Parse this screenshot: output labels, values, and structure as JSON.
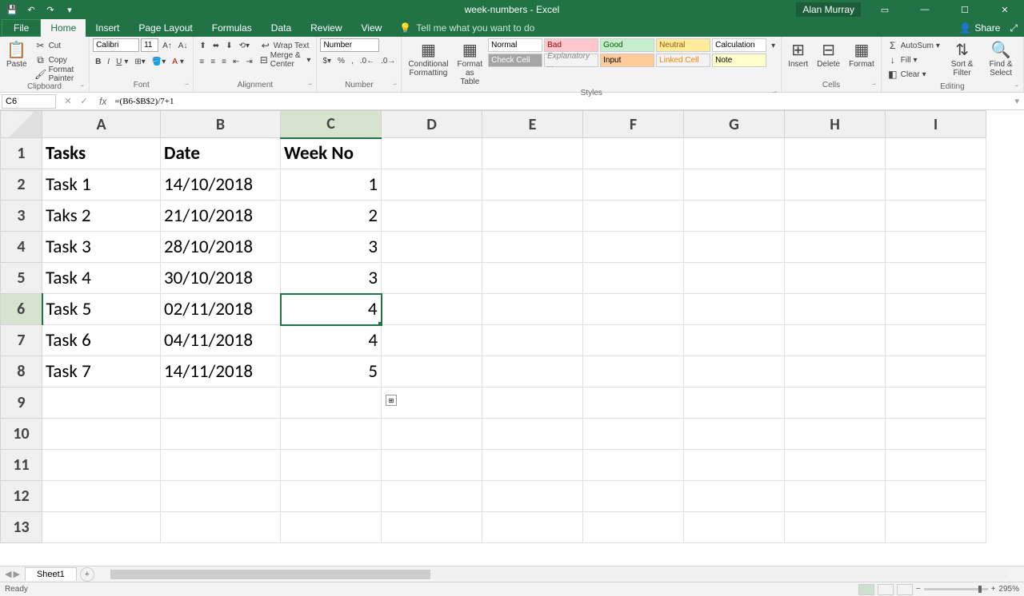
{
  "app": {
    "document_title": "week-numbers - Excel",
    "user_name": "Alan Murray"
  },
  "tabs": {
    "file": "File",
    "home": "Home",
    "insert": "Insert",
    "page_layout": "Page Layout",
    "formulas": "Formulas",
    "data": "Data",
    "review": "Review",
    "view": "View",
    "tell_me": "Tell me what you want to do",
    "share": "Share"
  },
  "ribbon": {
    "clipboard": {
      "label": "Clipboard",
      "paste": "Paste",
      "cut": "Cut",
      "copy": "Copy",
      "format_painter": "Format Painter"
    },
    "font": {
      "label": "Font",
      "name": "Calibri",
      "size": "11"
    },
    "alignment": {
      "label": "Alignment",
      "wrap": "Wrap Text",
      "merge": "Merge & Center"
    },
    "number": {
      "label": "Number",
      "format": "Number"
    },
    "styles": {
      "label": "Styles",
      "conditional": "Conditional Formatting",
      "format_as": "Format as Table",
      "normal": "Normal",
      "bad": "Bad",
      "good": "Good",
      "neutral": "Neutral",
      "check": "Check Cell",
      "explanatory": "Explanatory ...",
      "input": "Input",
      "linked": "Linked Cell",
      "note": "Note"
    },
    "cells": {
      "label": "Cells",
      "insert": "Insert",
      "delete": "Delete",
      "format": "Format"
    },
    "editing": {
      "label": "Editing",
      "autosum": "AutoSum",
      "fill": "Fill",
      "clear": "Clear",
      "sort": "Sort & Filter",
      "find": "Find & Select"
    }
  },
  "formulabar": {
    "cell_ref": "C6",
    "formula": "=(B6-$B$2)/7+1"
  },
  "columns": [
    "A",
    "B",
    "C",
    "D",
    "E",
    "F",
    "G",
    "H",
    "I"
  ],
  "selected_col": "C",
  "selected_row": 6,
  "rows": [
    {
      "n": 1,
      "A": "Tasks",
      "B": "Date",
      "C": "Week No",
      "bold": true
    },
    {
      "n": 2,
      "A": "Task 1",
      "B": "14/10/2018",
      "C": "1"
    },
    {
      "n": 3,
      "A": "Taks 2",
      "B": "21/10/2018",
      "C": "2"
    },
    {
      "n": 4,
      "A": "Task 3",
      "B": "28/10/2018",
      "C": "3"
    },
    {
      "n": 5,
      "A": "Task 4",
      "B": "30/10/2018",
      "C": "3"
    },
    {
      "n": 6,
      "A": "Task 5",
      "B": "02/11/2018",
      "C": "4"
    },
    {
      "n": 7,
      "A": "Task 6",
      "B": "04/11/2018",
      "C": "4"
    },
    {
      "n": 8,
      "A": "Task 7",
      "B": "14/11/2018",
      "C": "5"
    },
    {
      "n": 9
    },
    {
      "n": 10
    },
    {
      "n": 11
    },
    {
      "n": 12
    },
    {
      "n": 13
    }
  ],
  "sheet": {
    "name": "Sheet1"
  },
  "status": {
    "ready": "Ready",
    "zoom": "295%"
  }
}
